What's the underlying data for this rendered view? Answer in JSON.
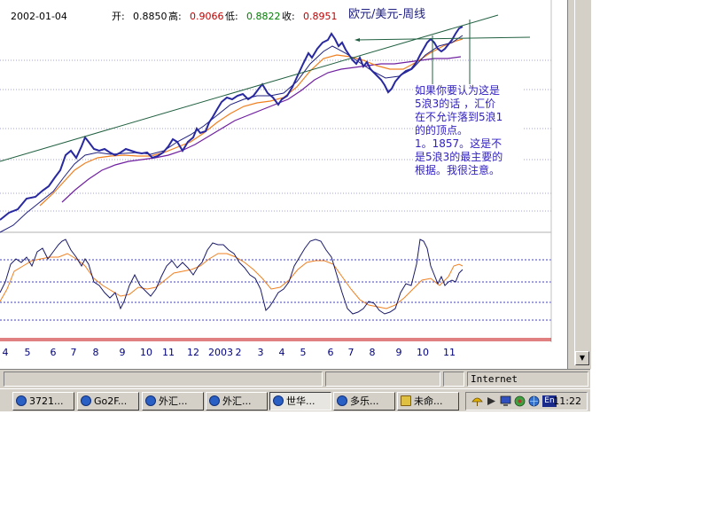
{
  "chart": {
    "date": "2002-01-04",
    "ohlc": [
      {
        "label": "开:",
        "value": "0.8850",
        "color": "#000000"
      },
      {
        "label": "高:",
        "value": "0.9066",
        "color": "#c00000"
      },
      {
        "label": "低:",
        "value": "0.8822",
        "color": "#008000"
      },
      {
        "label": "收:",
        "value": "0.8951",
        "color": "#c00000"
      }
    ],
    "title": "欧元/美元-周线",
    "annotation_lines": [
      "如果你要认为这是",
      "5浪3的话 ，汇价",
      "在不允许落到5浪1",
      "的的顶点。",
      "1。1857。这是不",
      "是5浪3的最主要的",
      "根据。我很注意。"
    ],
    "x_axis_labels": [
      "4",
      "5",
      "6",
      "7",
      "8",
      "9",
      "10",
      "11",
      "12",
      "2003",
      "2",
      "3",
      "4",
      "5",
      "6",
      "7",
      "8",
      "9",
      "10",
      "11"
    ],
    "colors": {
      "price": "#2828a0",
      "ma_fast": "#202080",
      "ma_mid": "#f08020",
      "ma_slow": "#7020a0",
      "trendline": "#206040",
      "osc_main": "#1a1a6a",
      "osc_signal": "#f08020",
      "grid": "#a0a0d0",
      "axis_red": "#c00000"
    }
  },
  "statusbar": {
    "zone": "Internet"
  },
  "taskbar": {
    "buttons": [
      {
        "label": "3721...",
        "icon": "ie-icon",
        "active": false
      },
      {
        "label": "Go2F...",
        "icon": "ie-icon",
        "active": false
      },
      {
        "label": "外汇...",
        "icon": "ie-icon",
        "active": false
      },
      {
        "label": "外汇...",
        "icon": "ie-icon",
        "active": false
      },
      {
        "label": "世华...",
        "icon": "ie-icon",
        "active": true
      },
      {
        "label": "多乐...",
        "icon": "ie-icon",
        "active": false
      },
      {
        "label": "未命...",
        "icon": "paint-icon",
        "active": false
      }
    ],
    "tray": {
      "lang": "En",
      "clock": "11:22"
    }
  }
}
